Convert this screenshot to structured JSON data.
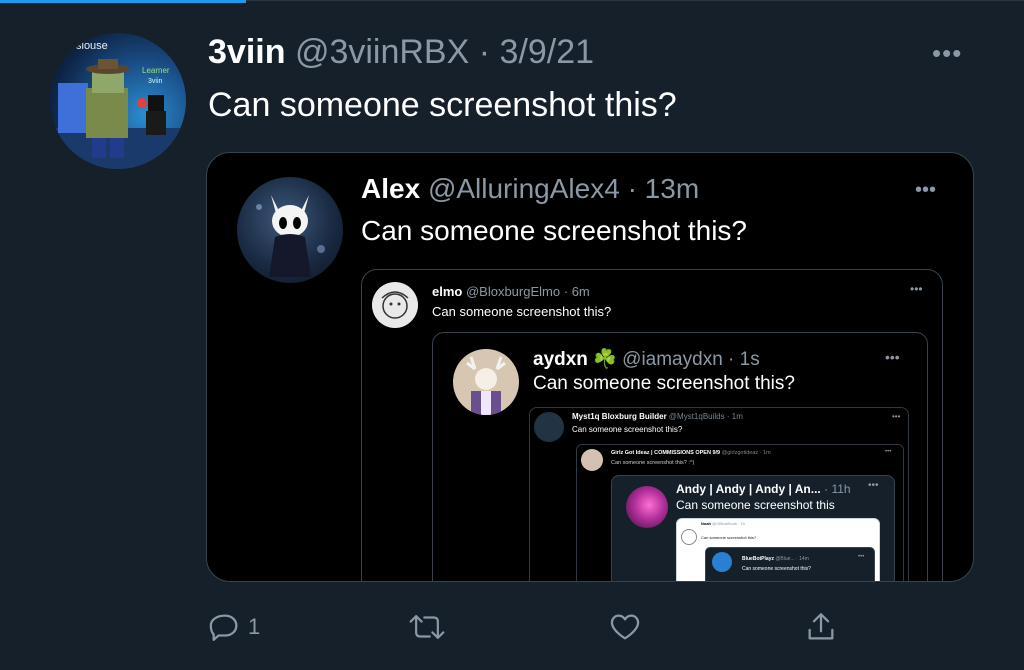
{
  "tweet": {
    "display_name": "3viin",
    "handle": "@3viinRBX",
    "date": "3/9/21",
    "text": "Can someone screenshot this?",
    "avatar_labels": {
      "player_name": "slouse",
      "badge": "Learner",
      "tag": "3viin"
    }
  },
  "quote1": {
    "display_name": "Alex",
    "handle": "@AlluringAlex4",
    "time": "13m",
    "text": "Can someone screenshot this?"
  },
  "quote2": {
    "display_name": "elmo",
    "handle": "@BloxburgElmo",
    "time": "6m",
    "text": "Can someone screenshot this?"
  },
  "quote3": {
    "display_name": "aydxn",
    "emoji": "☘️",
    "handle": "@iamaydxn",
    "time": "1s",
    "text": "Can someone screenshot this?"
  },
  "quote4": {
    "display_name": "Myst1q",
    "role": "Bloxburg Builder",
    "handle": "@Myst1qBuilds",
    "time": "1m",
    "text": "Can someone screenshot this?"
  },
  "quote5": {
    "display_name": "Girlz Got Ideaz | COMMISSIONS OPEN 9/9",
    "handle": "@girlzgotideaz",
    "time": "1m",
    "text": "Can someone screenshot this? :^)"
  },
  "quote6": {
    "display_name": "Andy | Andy | Andy | An...",
    "time": "11h",
    "text": "Can someone screenshot this"
  },
  "quote7": {
    "display_name": "Noah",
    "handle": "@OfficalNoah",
    "time": "1h",
    "text": "Can someone screenshot this?"
  },
  "quote8": {
    "display_name": "BlueBotPlayz",
    "handle": "@Blue...",
    "time": "14m",
    "text": "Can someone screenshot this?"
  },
  "actions": {
    "reply_count": "1"
  },
  "colors": {
    "background": "#15202b",
    "quote_background": "#000000",
    "muted": "#8b98a5",
    "accent": "#1d9bf0",
    "border": "#38444d"
  },
  "icons": [
    "more-icon",
    "reply-icon",
    "retweet-icon",
    "like-icon",
    "share-icon"
  ]
}
